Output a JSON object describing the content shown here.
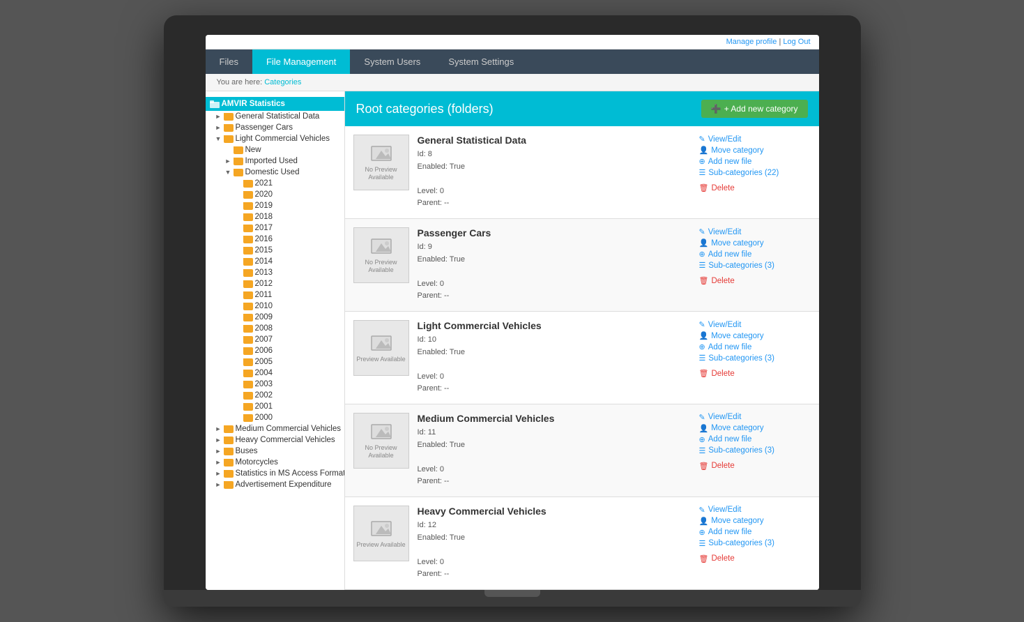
{
  "top_bar": {
    "manage_profile": "Manage profile",
    "separator": " | ",
    "log_out": "Log Out"
  },
  "nav": {
    "tabs": [
      {
        "label": "Files",
        "active": false
      },
      {
        "label": "File Management",
        "active": true
      },
      {
        "label": "System Users",
        "active": false
      },
      {
        "label": "System Settings",
        "active": false
      }
    ]
  },
  "breadcrumb": {
    "prefix": "You are here: ",
    "link": "Categories"
  },
  "sidebar": {
    "root": "AMVIR Statistics",
    "items": [
      {
        "label": "General Statistical Data",
        "indent": 1,
        "arrow": true
      },
      {
        "label": "Passenger Cars",
        "indent": 1,
        "arrow": true
      },
      {
        "label": "Light Commercial Vehicles",
        "indent": 1,
        "arrow": true,
        "open": true
      },
      {
        "label": "New",
        "indent": 2,
        "arrow": false
      },
      {
        "label": "Imported Used",
        "indent": 2,
        "arrow": true
      },
      {
        "label": "Domestic Used",
        "indent": 2,
        "arrow": true,
        "open": true
      },
      {
        "label": "2021",
        "indent": 3
      },
      {
        "label": "2020",
        "indent": 3
      },
      {
        "label": "2019",
        "indent": 3
      },
      {
        "label": "2018",
        "indent": 3
      },
      {
        "label": "2017",
        "indent": 3
      },
      {
        "label": "2016",
        "indent": 3
      },
      {
        "label": "2015",
        "indent": 3
      },
      {
        "label": "2014",
        "indent": 3
      },
      {
        "label": "2013",
        "indent": 3
      },
      {
        "label": "2012",
        "indent": 3
      },
      {
        "label": "2011",
        "indent": 3
      },
      {
        "label": "2010",
        "indent": 3
      },
      {
        "label": "2009",
        "indent": 3
      },
      {
        "label": "2008",
        "indent": 3
      },
      {
        "label": "2007",
        "indent": 3
      },
      {
        "label": "2006",
        "indent": 3
      },
      {
        "label": "2005",
        "indent": 3
      },
      {
        "label": "2004",
        "indent": 3
      },
      {
        "label": "2003",
        "indent": 3
      },
      {
        "label": "2002",
        "indent": 3
      },
      {
        "label": "2001",
        "indent": 3
      },
      {
        "label": "2000",
        "indent": 3
      },
      {
        "label": "Medium Commercial Vehicles",
        "indent": 1,
        "arrow": true
      },
      {
        "label": "Heavy Commercial Vehicles",
        "indent": 1,
        "arrow": true
      },
      {
        "label": "Buses",
        "indent": 1,
        "arrow": true
      },
      {
        "label": "Motorcycles",
        "indent": 1,
        "arrow": true
      },
      {
        "label": "Statistics in MS Access Format",
        "indent": 1,
        "arrow": true
      },
      {
        "label": "Advertisement Expenditure",
        "indent": 1,
        "arrow": true
      }
    ]
  },
  "content": {
    "title": "Root categories (folders)",
    "add_button": "+ Add new category",
    "categories": [
      {
        "name": "General Statistical Data",
        "id": "Id: 8",
        "enabled": "Enabled: True",
        "level": "Level: 0",
        "parent": "Parent: --",
        "preview": "No Preview Available",
        "has_preview": false,
        "actions": {
          "view_edit": "View/Edit",
          "move": "Move category",
          "add_file": "Add new file",
          "sub_categories": "Sub-categories (22)",
          "delete": "Delete"
        }
      },
      {
        "name": "Passenger Cars",
        "id": "Id: 9",
        "enabled": "Enabled: True",
        "level": "Level: 0",
        "parent": "Parent: --",
        "preview": "No Preview Available",
        "has_preview": false,
        "actions": {
          "view_edit": "View/Edit",
          "move": "Move category",
          "add_file": "Add new file",
          "sub_categories": "Sub-categories (3)",
          "delete": "Delete"
        }
      },
      {
        "name": "Light Commercial Vehicles",
        "id": "Id: 10",
        "enabled": "Enabled: True",
        "level": "Level: 0",
        "parent": "Parent: --",
        "preview": "Preview Available",
        "has_preview": true,
        "actions": {
          "view_edit": "View/Edit",
          "move": "Move category",
          "add_file": "Add new file",
          "sub_categories": "Sub-categories (3)",
          "delete": "Delete"
        }
      },
      {
        "name": "Medium Commercial Vehicles",
        "id": "Id: 11",
        "enabled": "Enabled: True",
        "level": "Level: 0",
        "parent": "Parent: --",
        "preview": "No Preview Available",
        "has_preview": false,
        "actions": {
          "view_edit": "View/Edit",
          "move": "Move category",
          "add_file": "Add new file",
          "sub_categories": "Sub-categories (3)",
          "delete": "Delete"
        }
      },
      {
        "name": "Heavy Commercial Vehicles",
        "id": "Id: 12",
        "enabled": "Enabled: True",
        "level": "Level: 0",
        "parent": "Parent: --",
        "preview": "Preview Available",
        "has_preview": true,
        "actions": {
          "view_edit": "View/Edit",
          "move": "Move category",
          "add_file": "Add new file",
          "sub_categories": "Sub-categories (3)",
          "delete": "Delete"
        }
      }
    ]
  }
}
